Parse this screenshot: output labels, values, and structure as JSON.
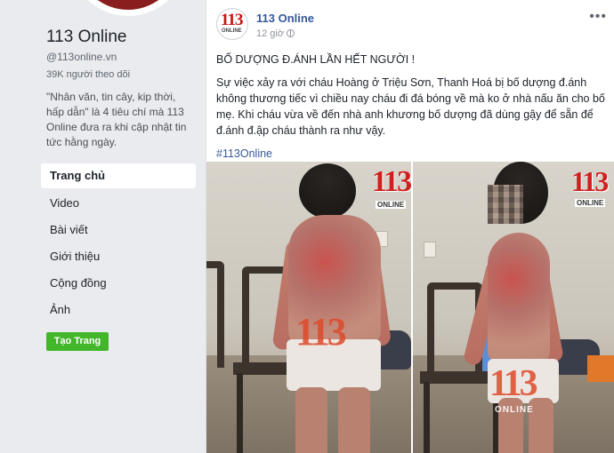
{
  "sidebar": {
    "page_name": "113 Online",
    "handle": "@113online.vn",
    "followers": "39K người theo dõi",
    "about": "\"Nhân văn, tin cây, kip thời, hấp dẫn\" là 4 tiêu chí mà 113 Online đưa ra khi cập nhật tin tức hằng ngày.",
    "nav": [
      {
        "label": "Trang chủ",
        "active": true
      },
      {
        "label": "Video"
      },
      {
        "label": "Bài viết"
      },
      {
        "label": "Giới thiệu"
      },
      {
        "label": "Cộng đồng"
      },
      {
        "label": "Ảnh"
      }
    ],
    "create_button": "Tạo Trang"
  },
  "post": {
    "author": "113 Online",
    "time": "12 giờ",
    "more_label": "•••",
    "avatar_logo_number": "113",
    "avatar_logo_text": "ONLINE",
    "headline": "BỐ DƯỢNG Đ.ÁNH LẦN HẾT NGƯỜI !",
    "body": "Sự việc xảy ra với cháu Hoàng ở Triệu Sơn, Thanh Hoá bị bố dượng đ.ánh không thương tiếc vì chiều nay cháu đi đá bóng về mà ko ở nhà nấu ăn cho bố mẹ. Khi cháu vừa về đến nhà anh khương bố dượng đã dùng gậy để sẵn để đ.ánh đ.ập cháu thành ra như vậy.",
    "hashtag": "#113Online",
    "watermark_number": "113",
    "watermark_text": "ONLINE"
  },
  "colors": {
    "link_blue": "#365899",
    "button_green": "#42b72a",
    "watermark_red": "#d11f1f",
    "background": "#e9ebee"
  }
}
